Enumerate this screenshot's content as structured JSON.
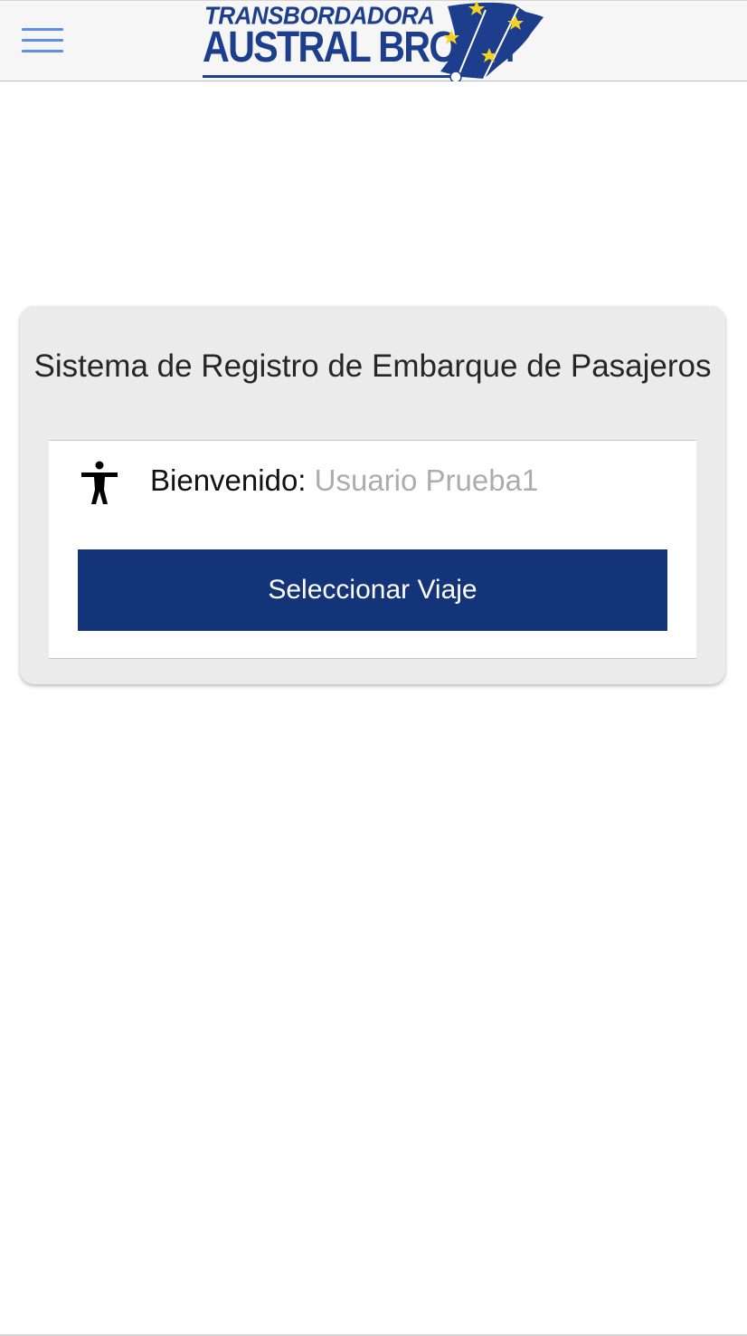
{
  "header": {
    "menu_icon": "hamburger-menu-icon",
    "logo": {
      "line1": "TRANSBORDADORA",
      "line2": "AUSTRAL BROOM",
      "colors": {
        "text": "#1d3e8d",
        "flag": "#1d3e8d",
        "stars": "#f4d21f"
      }
    },
    "menu_color": "#5b8fe8"
  },
  "card": {
    "title": "Sistema de Registro de Embarque de Pasajeros",
    "welcome_icon": "person-accessibility-icon",
    "welcome_label": "Bienvenido:",
    "user_name": "Usuario Prueba1",
    "button_label": "Seleccionar Viaje",
    "button_color": "#14347a"
  }
}
